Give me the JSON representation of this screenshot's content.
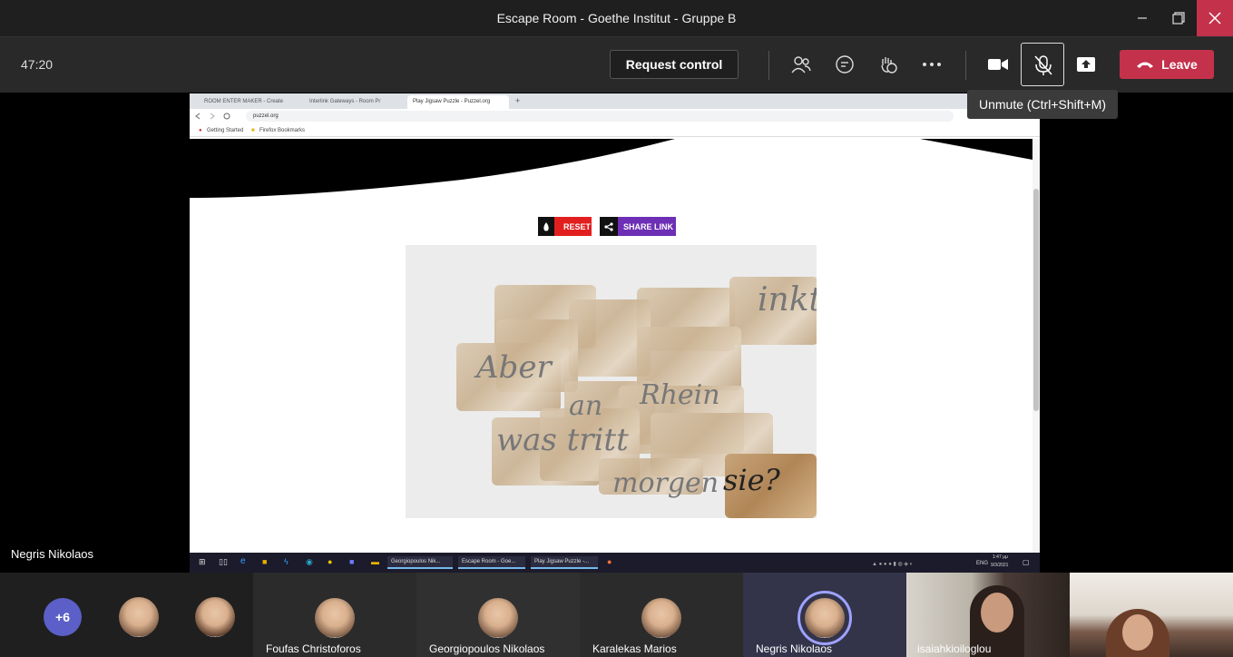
{
  "window": {
    "title": "Escape Room - Goethe Institut - Gruppe B"
  },
  "toolbar": {
    "timer": "47:20",
    "request_control": "Request control",
    "leave": "Leave",
    "tooltip": "Unmute (Ctrl+Shift+M)"
  },
  "browser": {
    "tabs": [
      "ROOM ENTER MAKER - Create",
      "Interlink Gateways - Room Pr",
      "Play Jigsaw Puzzle - Puzzel.org"
    ],
    "url": "puzzel.org",
    "bookmarks": [
      "Getting Started",
      "Firefox Bookmarks"
    ]
  },
  "puzzle_page": {
    "reset": "RESET",
    "share": "SHARE LINK",
    "words": [
      "inkt",
      "Aber",
      "an",
      "Rhein",
      "was tritt",
      "sie?",
      "morgen"
    ]
  },
  "win_taskbar": {
    "items": [
      "Georgiopoulos Nik...",
      "Escape Room - Goe...",
      "Play Jigsaw Puzzle -..."
    ],
    "lang": "ENG",
    "time": "1:47 μμ",
    "date": "9/3/2021"
  },
  "speaker_label": "Negris Nikolaos",
  "participants": {
    "more": "+6",
    "tiles": [
      "Foufas Christoforos",
      "Georgiopoulos Nikolaos",
      "Karalekas Marios",
      "Negris Nikolaos",
      "isaiahkioiloglou"
    ]
  },
  "colors": {
    "leave": "#c4314b",
    "accent": "#5b5fc7",
    "reset": "#e21f1f",
    "share": "#6d2fb5"
  }
}
